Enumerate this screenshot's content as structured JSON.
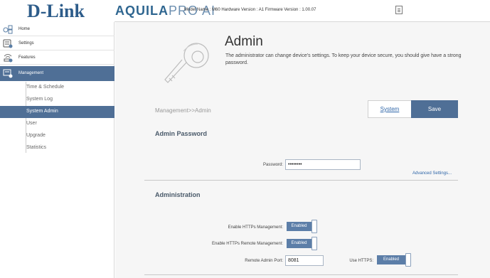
{
  "header": {
    "logo": "D-Link",
    "brand_primary": "AQUILA",
    "brand_secondary": "PRO AI",
    "device_info": "Model Name : M60 Hardware Version : A1 Firmware Version : 1.00.07",
    "icon": "document-icon"
  },
  "sidebar": {
    "items": [
      {
        "label": "Home",
        "icon": "home-icon"
      },
      {
        "label": "Settings",
        "icon": "settings-icon"
      },
      {
        "label": "Features",
        "icon": "features-icon"
      },
      {
        "label": "Management",
        "icon": "management-icon"
      }
    ],
    "subitems": [
      {
        "label": "Time & Schedule"
      },
      {
        "label": "System Log"
      },
      {
        "label": "System Admin"
      },
      {
        "label": "User"
      },
      {
        "label": "Upgrade"
      },
      {
        "label": "Statistics"
      }
    ],
    "active_item": "Management",
    "active_subitem": "System Admin"
  },
  "page": {
    "title": "Admin",
    "description": "The administrator can change device's settings. To keep your device secure, you should give have a strong password.",
    "breadcrumb": "Management>>Admin",
    "system_button": "System",
    "save_button": "Save"
  },
  "admin_password": {
    "section_title": "Admin Password",
    "password_label": "Password:",
    "password_value": "••••••••",
    "advanced_link": "Advanced Settings..."
  },
  "administration": {
    "section_title": "Administration",
    "https_mgmt_label": "Enable HTTPs Management:",
    "https_mgmt_value": "Enabled",
    "https_remote_label": "Enable HTTPs Remote Management:",
    "https_remote_value": "Enabled",
    "remote_port_label": "Remote Admin Port:",
    "remote_port_value": "8081",
    "use_https_label": "Use HTTPS:",
    "use_https_value": "Enabled"
  },
  "colors": {
    "accent": "#4f6f96",
    "link": "#2f66a8",
    "logo": "#2d5c8a"
  }
}
